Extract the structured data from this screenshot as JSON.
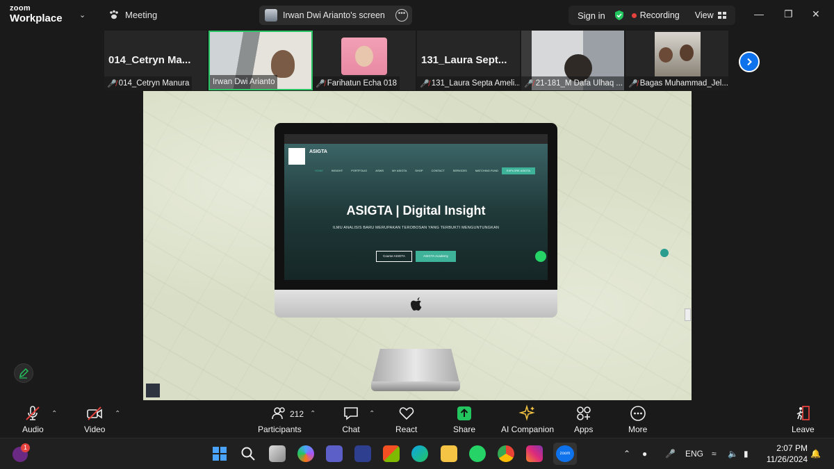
{
  "title_bar": {
    "logo_line1": "zoom",
    "logo_line2": "Workplace",
    "meeting_label": "Meeting",
    "screen_share_label": "Irwan Dwi Arianto's screen",
    "sign_in": "Sign in",
    "recording": "Recording",
    "view": "View"
  },
  "participants": [
    {
      "big_name": "014_Cetryn  Ma...",
      "label": "014_Cetryn Manura",
      "muted": true,
      "has_video": false,
      "active": false
    },
    {
      "big_name": "",
      "label": "Irwan Dwi Arianto",
      "muted": false,
      "has_video": true,
      "active": true
    },
    {
      "big_name": "",
      "label": "Farihatun Echa 018",
      "muted": true,
      "has_video": true,
      "active": false
    },
    {
      "big_name": "131_Laura  Sept...",
      "label": "131_Laura Septa Ameli...",
      "muted": true,
      "has_video": false,
      "active": false
    },
    {
      "big_name": "",
      "label": "21-181_M Dafa Ulhaq ...",
      "muted": true,
      "has_video": true,
      "active": false
    },
    {
      "big_name": "",
      "label": "Bagas Muhammad_Jel...",
      "muted": true,
      "has_video": true,
      "active": false
    }
  ],
  "shared_site": {
    "site_name": "ASIGTA",
    "nav": [
      "HOME",
      "INSIGHT",
      "PORTFOLIO",
      "ASWS",
      "MY ASIGTA",
      "SHOP",
      "CONTACT",
      "SERVICES",
      "MATCHING FUND"
    ],
    "nav_button": "EXPLORE ASIGTA",
    "hero_title": "ASIGTA | Digital Insight",
    "hero_subtitle": "ILMU ANALISIS BARU MERUPAKAN TEROBOSAN YANG TERBUKTI MENGUNTUNGKAN",
    "button1": "Course ASIGTA",
    "button2": "ASIGTA Academy"
  },
  "toolbar": {
    "audio": "Audio",
    "video": "Video",
    "participants": "Participants",
    "participant_count": "212",
    "chat": "Chat",
    "react": "React",
    "share": "Share",
    "ai_companion": "AI Companion",
    "apps": "Apps",
    "more": "More",
    "leave": "Leave"
  },
  "taskbar": {
    "notification_badge": "1",
    "language": "ENG",
    "time": "2:07 PM",
    "date": "11/26/2024",
    "zoom_label": "zoom"
  },
  "colors": {
    "zoom_blue": "#0e72ed",
    "active_green": "#28c463",
    "muted_red": "#e5413d",
    "share_green": "#22c55e"
  }
}
